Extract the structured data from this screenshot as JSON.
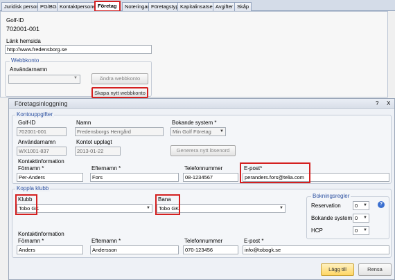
{
  "tabs": [
    "Juridisk person",
    "PG/BG",
    "Kontaktpersoner",
    "Företag",
    "Noteringar",
    "Företagstyp",
    "Kapitalinsatser",
    "Avgifter",
    "Skåp"
  ],
  "company": {
    "golf_id_label": "Golf-ID",
    "golf_id": "702001-001",
    "homepage_label": "Länk hemsida",
    "homepage": "http://www.fredensborg.se"
  },
  "webaccount": {
    "title": "Webbkonto",
    "username_label": "Användarnamn",
    "username": "",
    "change_button": "Ändra webbkonto",
    "create_button": "Skapa nytt webbkonto"
  },
  "dialog": {
    "title": "Företagsinloggning",
    "help": "?",
    "close": "X",
    "account": {
      "title": "Kontouppgifter",
      "golf_id_label": "Golf-ID",
      "golf_id": "702001-001",
      "name_label": "Namn",
      "name": "Fredensborgs Herrgård",
      "booking_system_label": "Bokande system *",
      "booking_system": "Min Golf Företag",
      "username_label": "Användarnamn",
      "username": "WX1001-837",
      "created_label": "Kontot upplagt",
      "created": "2013-01-22",
      "generate_button": "Generera nytt lösenord",
      "contact_label": "Kontaktinformation",
      "firstname_label": "Förnamn *",
      "firstname": "Per-Anders",
      "lastname_label": "Efternamn *",
      "lastname": "Fors",
      "phone_label": "Telefonnummer",
      "phone": "08-1234567",
      "email_label": "E-post*",
      "email": "peranders.fors@telia.com"
    },
    "club": {
      "title": "Koppla klubb",
      "club_label": "Klubb",
      "club": "Tobo GK",
      "course_label": "Bana",
      "course": "Tobo GK",
      "booking_rules": {
        "title": "Bokningsregler",
        "reservation_label": "Reservation",
        "reservation": "0",
        "booking_system_label": "Bokande system",
        "booking_system": "0",
        "hcp_label": "HCP",
        "hcp": "0"
      },
      "contact_label": "Kontaktinformation",
      "firstname_label": "Förnamn *",
      "firstname": "Anders",
      "lastname_label": "Efternamn *",
      "lastname": "Andersson",
      "phone_label": "Telefonnummer",
      "phone": "070-123456",
      "email_label": "E-post *",
      "email": "info@tobogk.se"
    },
    "add_button": "Lägg till",
    "clear_button": "Rensa"
  }
}
